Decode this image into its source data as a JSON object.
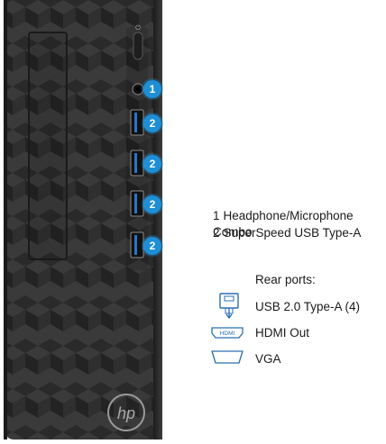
{
  "device": {
    "brand_logo": "hp-logo",
    "front_ports": [
      {
        "callout": "1",
        "port_icon": "audio-jack-icon"
      },
      {
        "callout": "2",
        "port_icon": "usb-port-icon"
      },
      {
        "callout": "2",
        "port_icon": "usb-port-icon"
      },
      {
        "callout": "2",
        "port_icon": "usb-port-icon"
      },
      {
        "callout": "2",
        "port_icon": "usb-port-icon"
      }
    ]
  },
  "legend": {
    "items": [
      {
        "num": "1",
        "text": "Headphone/Microphone Combo"
      },
      {
        "num": "2",
        "text": "SuperSpeed USB Type-A"
      }
    ]
  },
  "rear": {
    "title": "Rear ports:",
    "items": [
      {
        "icon": "usb-a-icon",
        "label": "USB 2.0 Type-A (4)"
      },
      {
        "icon": "hdmi-icon",
        "label": "HDMI Out",
        "icon_text": "HDMI"
      },
      {
        "icon": "vga-icon",
        "label": "VGA"
      }
    ]
  },
  "colors": {
    "callout": "#1e8fd6",
    "chassis": "#2b2b2b",
    "icon_blue": "#2a6fb0"
  }
}
